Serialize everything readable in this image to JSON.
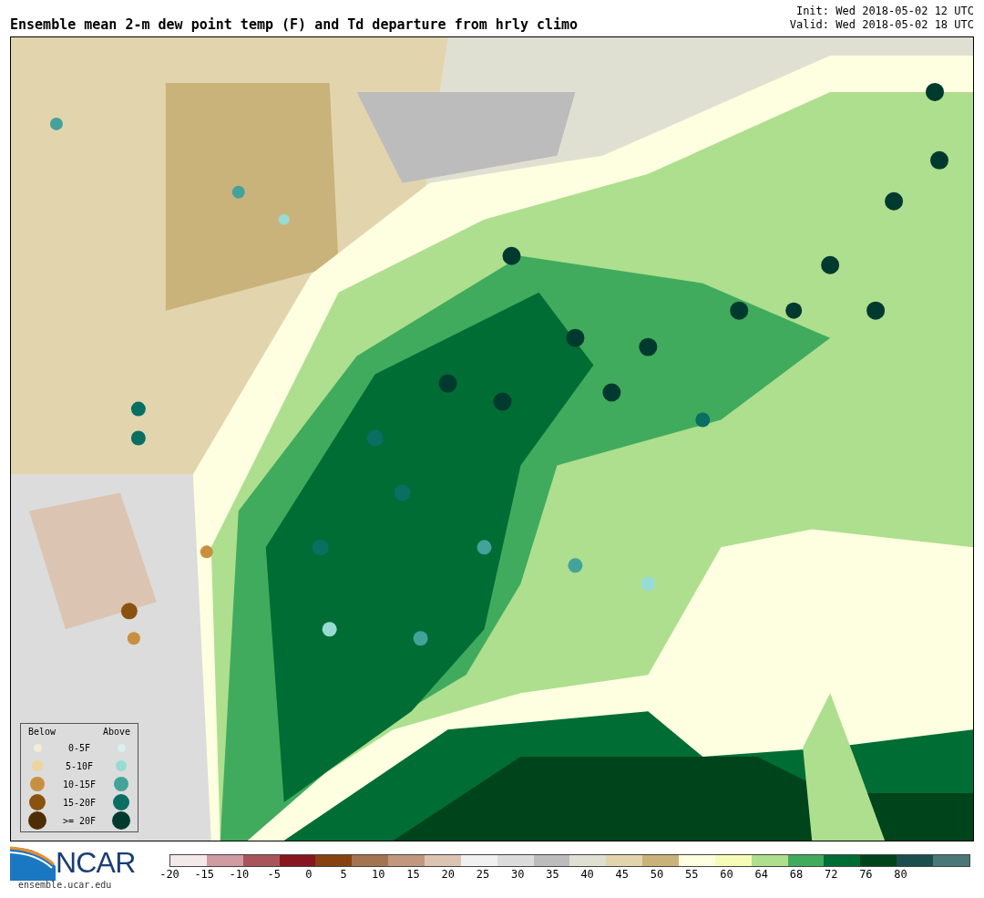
{
  "title": "Ensemble mean 2-m dew point temp (F) and Td departure from hrly climo",
  "init": "Init: Wed 2018-05-02 12 UTC",
  "valid": "Valid: Wed 2018-05-02 18 UTC",
  "dot_legend": {
    "below_heading": "Below",
    "above_heading": "Above",
    "rows": [
      {
        "label": "0-5F",
        "below": {
          "color": "#f3ecd6"
        },
        "above": {
          "color": "#d8f0ee"
        }
      },
      {
        "label": "5-10F",
        "below": {
          "color": "#ecd49a"
        },
        "above": {
          "color": "#96dcd2"
        }
      },
      {
        "label": "10-15F",
        "below": {
          "color": "#c98f40"
        },
        "above": {
          "color": "#43a39a"
        }
      },
      {
        "label": "15-20F",
        "below": {
          "color": "#8a520e"
        },
        "above": {
          "color": "#0a6e63"
        }
      },
      {
        "label": ">= 20F",
        "below": {
          "color": "#4f2d04"
        },
        "above": {
          "color": "#003a2e"
        }
      }
    ]
  },
  "logo": {
    "text": "NCAR",
    "url": "ensemble.ucar.edu"
  },
  "colorbar": {
    "swatches": [
      {
        "color": "#f3e9e9"
      },
      {
        "color": "#cf9ba0"
      },
      {
        "color": "#a9545b"
      },
      {
        "color": "#861720"
      },
      {
        "color": "#864210"
      },
      {
        "color": "#a47451"
      },
      {
        "color": "#c1987d"
      },
      {
        "color": "#dcc4b2"
      },
      {
        "color": "#f0f0f0"
      },
      {
        "color": "#dcdcdc"
      },
      {
        "color": "#bcbcbc"
      },
      {
        "color": "#e0e0d2"
      },
      {
        "color": "#e2d5ae"
      },
      {
        "color": "#c9b37a"
      },
      {
        "color": "#fefee0"
      },
      {
        "color": "#f6fcb7"
      },
      {
        "color": "#addf8e"
      },
      {
        "color": "#41ab5d"
      },
      {
        "color": "#006d35"
      },
      {
        "color": "#00441b"
      },
      {
        "color": "#1b4e4e"
      },
      {
        "color": "#4a7777"
      }
    ],
    "ticks": [
      "-20",
      "-15",
      "-10",
      "-5",
      "0",
      "5",
      "10",
      "15",
      "20",
      "25",
      "30",
      "35",
      "40",
      "45",
      "50",
      "55",
      "60",
      "64",
      "68",
      "72",
      "76",
      "80"
    ]
  }
}
